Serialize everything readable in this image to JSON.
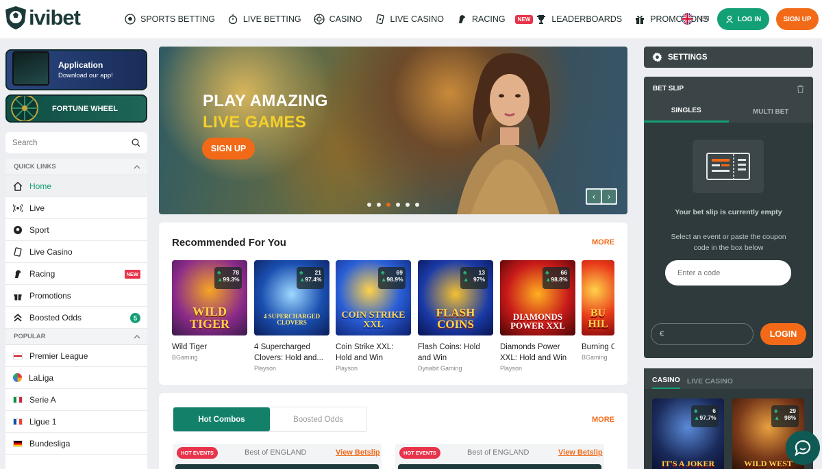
{
  "brand": {
    "name": "ivibet"
  },
  "nav": {
    "items": [
      {
        "label": "SPORTS BETTING",
        "icon": "soccer-ball-icon"
      },
      {
        "label": "LIVE BETTING",
        "icon": "stopwatch-icon"
      },
      {
        "label": "CASINO",
        "icon": "roulette-icon"
      },
      {
        "label": "LIVE CASINO",
        "icon": "cards-icon"
      },
      {
        "label": "RACING",
        "icon": "horse-icon",
        "badge": "NEW"
      },
      {
        "label": "LEADERBOARDS",
        "icon": "trophy-icon"
      },
      {
        "label": "PROMOTIONS",
        "icon": "gift-icon"
      }
    ],
    "more": "•••"
  },
  "header": {
    "lang": "EN",
    "login_label": "LOG IN",
    "signup_label": "SIGN UP"
  },
  "sidebar": {
    "app_title": "Application",
    "app_subtitle": "Download our app!",
    "wheel_label": "FORTUNE WHEEL",
    "search_placeholder": "Search",
    "quick_links_title": "QUICK LINKS",
    "quick_links": [
      {
        "label": "Home",
        "icon": "home-icon"
      },
      {
        "label": "Live",
        "icon": "live-icon"
      },
      {
        "label": "Sport",
        "icon": "soccer-ball-icon"
      },
      {
        "label": "Live Casino",
        "icon": "cards-icon"
      },
      {
        "label": "Racing",
        "icon": "horse-icon",
        "badge": "NEW"
      },
      {
        "label": "Promotions",
        "icon": "gift-icon"
      },
      {
        "label": "Boosted Odds",
        "icon": "boost-icon",
        "count": "5"
      }
    ],
    "popular_title": "POPULAR",
    "popular": [
      {
        "label": "Premier League",
        "flag": "england"
      },
      {
        "label": "LaLiga",
        "flag": "laliga"
      },
      {
        "label": "Serie A",
        "flag": "italy"
      },
      {
        "label": "Ligue 1",
        "flag": "france"
      },
      {
        "label": "Bundesliga",
        "flag": "germany"
      }
    ]
  },
  "banner": {
    "line1": "PLAY AMAZING",
    "line2": "LIVE GAMES",
    "cta": "SIGN UP",
    "prev": "‹",
    "next": "›"
  },
  "recommended": {
    "title": "Recommended For You",
    "more": "MORE",
    "games": [
      {
        "name": "Wild Tiger",
        "provider": "BGaming",
        "players": "78",
        "rtp": "99.3%",
        "art": "WILD TIGER"
      },
      {
        "name": "4 Supercharged Clovers: Hold and...",
        "provider": "Playson",
        "players": "21",
        "rtp": "97.4%",
        "art": "4 SUPERCHARGED CLOVERS"
      },
      {
        "name": "Coin Strike XXL: Hold and Win",
        "provider": "Playson",
        "players": "69",
        "rtp": "98.9%",
        "art": "COIN STRIKE XXL"
      },
      {
        "name": "Flash Coins: Hold and Win",
        "provider": "Dynabit Gaming",
        "players": "13",
        "rtp": "97%",
        "art": "FLASH COINS"
      },
      {
        "name": "Diamonds Power XXL: Hold and Win",
        "provider": "Playson",
        "players": "66",
        "rtp": "98.8%",
        "art": "DIAMONDS POWER XXL"
      },
      {
        "name": "Burning C",
        "provider": "BGaming",
        "players": "",
        "rtp": "",
        "art": "BU HIL"
      }
    ]
  },
  "combos": {
    "tab_active": "Hot Combos",
    "tab_other": "Boosted Odds",
    "more": "MORE",
    "cards": [
      {
        "tag": "HOT EVENTS",
        "title": "Best of ENGLAND",
        "link": "View Betslip"
      },
      {
        "tag": "HOT EVENTS",
        "title": "Best of ENGLAND",
        "link": "View Betslip"
      }
    ]
  },
  "betslip": {
    "settings_label": "SETTINGS",
    "title": "BET SLIP",
    "tab_singles": "SINGLES",
    "tab_multi": "MULTI BET",
    "empty_title": "Your bet slip is currently empty",
    "help_text": "Select an event or paste the coupon code in the box below",
    "code_placeholder": "Enter a code",
    "currency": "€",
    "login_label": "LOGIN"
  },
  "casino_widget": {
    "tab_active": "CASINO",
    "tab_other": "LIVE CASINO",
    "games": [
      {
        "players": "6",
        "rtp": "97.7%",
        "art": "IT'S A JOKER"
      },
      {
        "players": "29",
        "rtp": "98%",
        "art": "WILD WEST"
      }
    ]
  },
  "colors": {
    "accent_green": "#13a076",
    "accent_orange": "#f26a17",
    "dark_panel": "#2f3a3c",
    "badge_red": "#e8344b"
  }
}
